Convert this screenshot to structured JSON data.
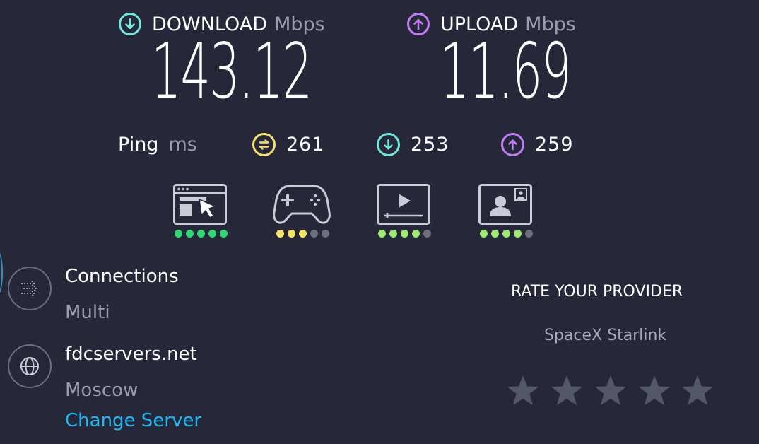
{
  "download": {
    "title": "DOWNLOAD",
    "unit": "Mbps",
    "value": "143.12",
    "icon": "download-arrow-icon",
    "color": "#6fe6de"
  },
  "upload": {
    "title": "UPLOAD",
    "unit": "Mbps",
    "value": "11.69",
    "icon": "upload-arrow-icon",
    "color": "#c07cf2"
  },
  "ping": {
    "label": "Ping",
    "unit": "ms",
    "idle": "261",
    "download": "253",
    "upload": "259",
    "idle_color": "#f5e06a",
    "download_color": "#6fe6de",
    "upload_color": "#c07cf2"
  },
  "quality_ratings": [
    {
      "name": "web-browsing",
      "icon": "web-browsing-icon",
      "level": 5,
      "color": "#2fd873"
    },
    {
      "name": "gaming",
      "icon": "gamepad-icon",
      "level": 3,
      "color": "#f7e56a"
    },
    {
      "name": "video-streaming",
      "icon": "video-play-icon",
      "level": 4,
      "color": "#9be872"
    },
    {
      "name": "video-chat",
      "icon": "video-chat-icon",
      "level": 4,
      "color": "#9be872"
    }
  ],
  "connections": {
    "label": "Connections",
    "value": "Multi",
    "icon": "connections-icon"
  },
  "server": {
    "host": "fdcservers.net",
    "location": "Moscow",
    "change_label": "Change Server",
    "icon": "globe-icon",
    "link_color": "#1fb6f0"
  },
  "rate": {
    "heading": "RATE YOUR PROVIDER",
    "provider": "SpaceX Starlink",
    "stars": 5
  }
}
